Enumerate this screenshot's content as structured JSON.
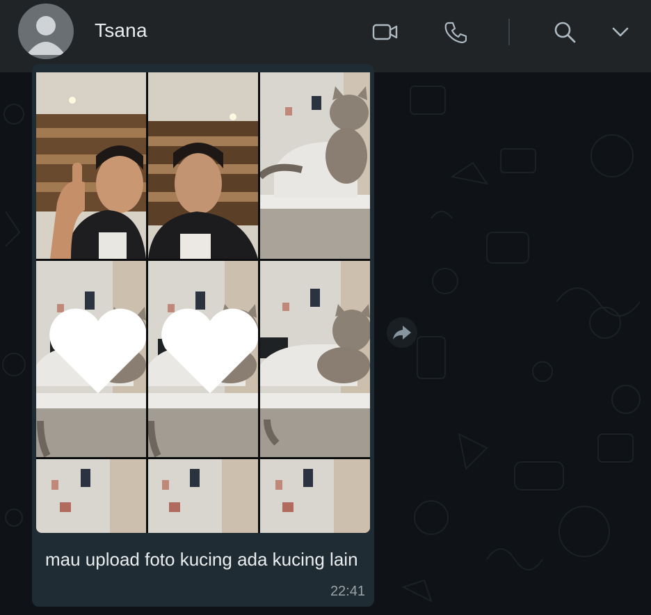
{
  "header": {
    "contact_name": "Tsana",
    "icons": [
      "avatar-placeholder-icon",
      "video-call-icon",
      "voice-call-icon",
      "search-icon",
      "chevron-down-icon"
    ]
  },
  "message": {
    "caption": "mau upload foto kucing ada kucing lain",
    "time": "22:41",
    "photos": [
      {
        "subject": "man-thumbs-up",
        "favorite": false
      },
      {
        "subject": "man-selfie",
        "favorite": false
      },
      {
        "subject": "cat-on-desk",
        "favorite": false
      },
      {
        "subject": "cat-on-desk",
        "favorite": true
      },
      {
        "subject": "cat-on-desk",
        "favorite": true
      },
      {
        "subject": "cat-on-desk",
        "favorite": false
      },
      {
        "subject": "room-wall",
        "favorite": false
      },
      {
        "subject": "room-wall",
        "favorite": false
      },
      {
        "subject": "room-wall",
        "favorite": false
      }
    ]
  },
  "actions": {
    "forward_icon": "forward-arrow-icon"
  },
  "colors": {
    "header_bg": "#202427",
    "bubble_bg": "#202c33",
    "wallpaper_bg": "#0f1317",
    "text_primary": "#e9edef",
    "text_secondary": "#9aa3a8"
  }
}
